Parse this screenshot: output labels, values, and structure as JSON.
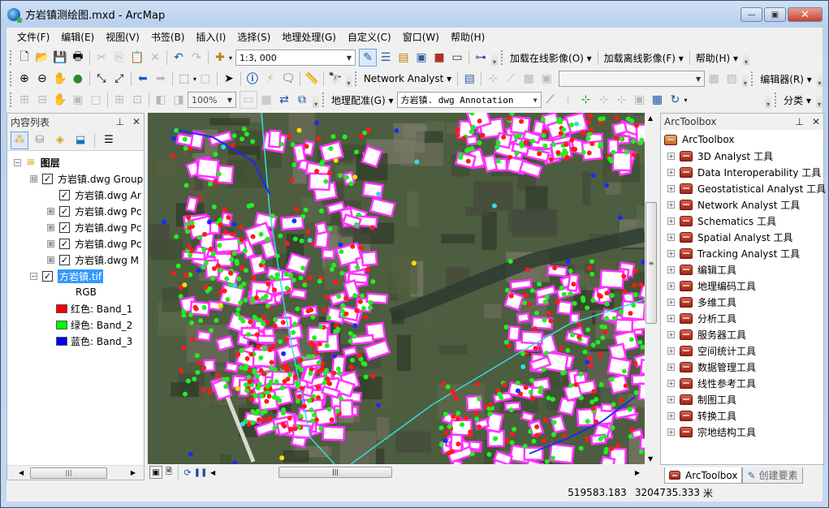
{
  "window": {
    "title": "方岩镇测绘图.mxd - ArcMap",
    "minimize": "—",
    "maximize": "▣",
    "close": "✕"
  },
  "menu": [
    "文件(F)",
    "编辑(E)",
    "视图(V)",
    "书签(B)",
    "插入(I)",
    "选择(S)",
    "地理处理(G)",
    "自定义(C)",
    "窗口(W)",
    "帮助(H)"
  ],
  "toolbar1": {
    "scale": "1:3, 000",
    "load_online": "加载在线影像(O)",
    "load_offline": "加载离线影像(F)",
    "help": "帮助(H)"
  },
  "toolbar2": {
    "network_analyst": "Network Analyst",
    "editor": "编辑器(R)"
  },
  "toolbar3": {
    "zoom_percent": "100%",
    "georef": "地理配准(G)",
    "annotation_layer": "方岩镇. dwg Annotation",
    "classify": "分类"
  },
  "toc": {
    "title": "内容列表",
    "root": "图层",
    "layers": [
      {
        "label": "方岩镇.dwg Group",
        "expander": "⊟",
        "checked": true
      },
      {
        "label": "方岩镇.dwg Ar",
        "expander": "",
        "checked": true
      },
      {
        "label": "方岩镇.dwg Pc",
        "expander": "⊞",
        "checked": true
      },
      {
        "label": "方岩镇.dwg Pc",
        "expander": "⊞",
        "checked": true
      },
      {
        "label": "方岩镇.dwg Pc",
        "expander": "⊞",
        "checked": true
      },
      {
        "label": "方岩镇.dwg M",
        "expander": "⊞",
        "checked": true
      }
    ],
    "raster": {
      "label": "方岩镇.tif",
      "mode": "RGB",
      "bands": [
        {
          "label": "红色:    Band_1",
          "color": "#ff0000"
        },
        {
          "label": "绿色: Band_2",
          "color": "#00ff00"
        },
        {
          "label": "蓝色:    Band_3",
          "color": "#0000ff"
        }
      ]
    }
  },
  "toolbox": {
    "title": "ArcToolbox",
    "root": "ArcToolbox",
    "items": [
      "3D Analyst 工具",
      "Data Interoperability 工具",
      "Geostatistical Analyst 工具",
      "Network Analyst 工具",
      "Schematics 工具",
      "Spatial Analyst 工具",
      "Tracking Analyst 工具",
      "编辑工具",
      "地理编码工具",
      "多维工具",
      "分析工具",
      "服务器工具",
      "空间统计工具",
      "数据管理工具",
      "线性参考工具",
      "制图工具",
      "转换工具",
      "宗地结构工具"
    ],
    "tabs": [
      "ArcToolbox",
      "创建要素"
    ]
  },
  "status": {
    "x": "519583.183",
    "y": "3204735.333",
    "unit": "米"
  },
  "map_colors": {
    "building": "#ff33ff",
    "tree": "#22ee22",
    "point": "#ff1a1a",
    "road": "#33dddd",
    "boundary": "#1a2bff"
  }
}
